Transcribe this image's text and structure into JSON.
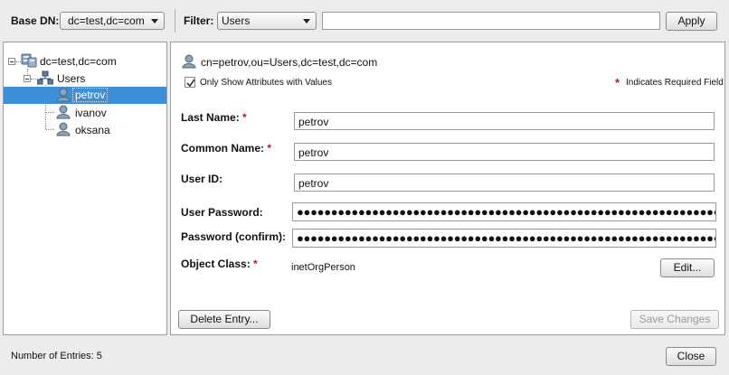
{
  "toolbar": {
    "base_dn_label": "Base DN:",
    "base_dn_value": "dc=test,dc=com",
    "filter_label": "Filter:",
    "filter_value": "Users",
    "filter_text": "",
    "apply_label": "Apply"
  },
  "tree": {
    "root": "dc=test,dc=com",
    "group": "Users",
    "items": [
      "petrov",
      "ivanov",
      "oksana"
    ],
    "selected": "petrov"
  },
  "entry": {
    "dn": "cn=petrov,ou=Users,dc=test,dc=com",
    "only_show_label": "Only Show Attributes with Values",
    "only_show_checked": true,
    "required_note": "Indicates Required Field",
    "required_marker": "*",
    "attributes": {
      "last_name_label": "Last Name:",
      "last_name_value": "petrov",
      "common_name_label": "Common Name:",
      "common_name_value": "petrov",
      "user_id_label": "User ID:",
      "user_id_value": "petrov",
      "password_label": "User Password:",
      "password_value": "●●●●●●●●●●●●●●●●●●●●●●●●●●●●●●●●●●●●●●●●●●●●●●●●●●●●●●●●●●●●●●●●●●",
      "password_confirm_label": "Password (confirm):",
      "password_confirm_value": "●●●●●●●●●●●●●●●●●●●●●●●●●●●●●●●●●●●●●●●●●●●●●●●●●●●●●●●●●●●●●●●●●●",
      "object_class_label": "Object Class:",
      "object_class_value": "inetOrgPerson"
    },
    "edit_label": "Edit...",
    "delete_label": "Delete Entry...",
    "save_label": "Save Changes"
  },
  "footer": {
    "entries_label": "Number of Entries: 5",
    "close_label": "Close"
  },
  "colors": {
    "selection": "#3d8fd9",
    "required": "#c0161b"
  }
}
